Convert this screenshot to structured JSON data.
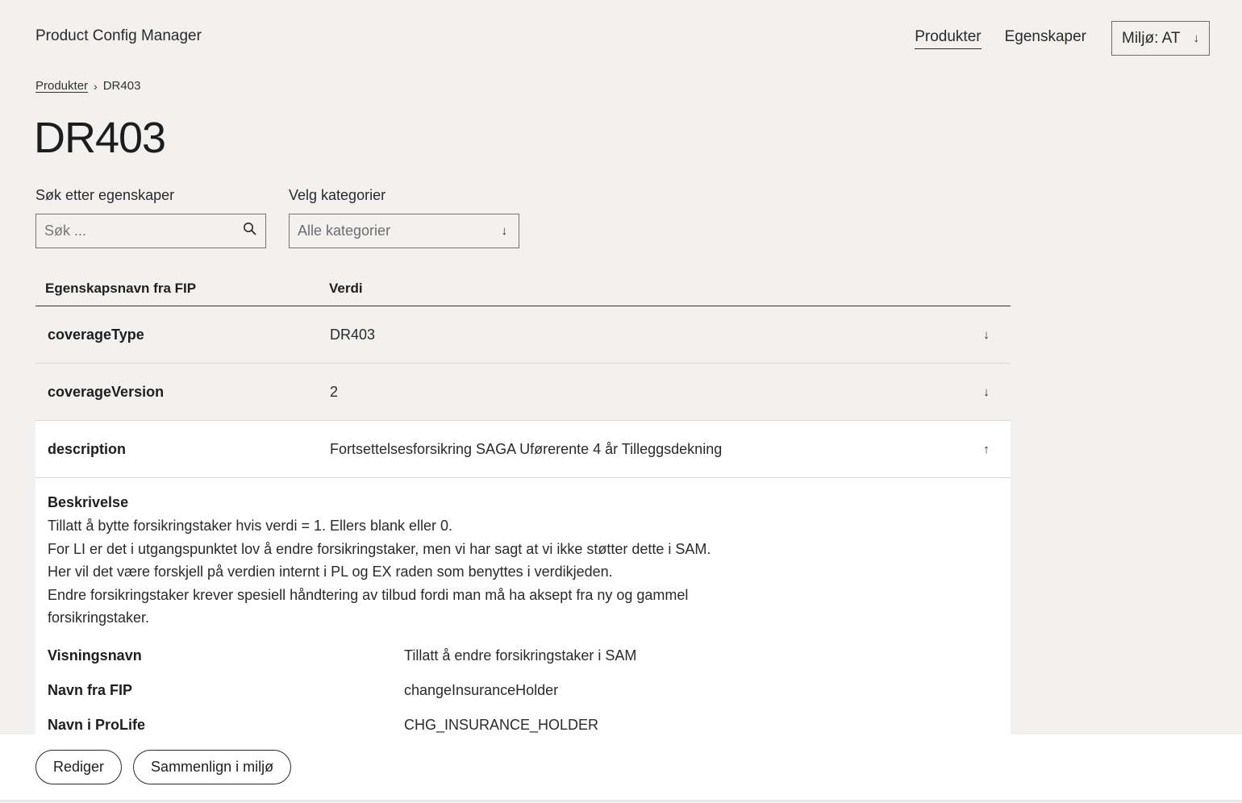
{
  "app": {
    "title": "Product Config Manager"
  },
  "nav": {
    "items": [
      {
        "label": "Produkter"
      },
      {
        "label": "Egenskaper"
      }
    ],
    "environment": {
      "label": "Miljø: AT",
      "arrow": "↓"
    }
  },
  "breadcrumb": {
    "parent": "Produkter",
    "separator": "›",
    "current": "DR403"
  },
  "page": {
    "title": "DR403"
  },
  "filters": {
    "search": {
      "label": "Søk etter egenskaper",
      "placeholder": "Søk ..."
    },
    "category": {
      "label": "Velg kategorier",
      "selected": "Alle kategorier",
      "arrow": "↓"
    }
  },
  "table": {
    "headers": {
      "name": "Egenskapsnavn fra FIP",
      "value": "Verdi"
    },
    "rows": [
      {
        "name": "coverageType",
        "value": "DR403",
        "toggle": "↓"
      },
      {
        "name": "coverageVersion",
        "value": "2",
        "toggle": "↓"
      },
      {
        "name": "description",
        "value": "Fortsettelsesforsikring SAGA Uførerente 4 år Tilleggsdekning",
        "toggle": "↑"
      }
    ],
    "detail": {
      "heading": "Beskrivelse",
      "lines": [
        "Tillatt å bytte forsikringstaker hvis verdi = 1. Ellers blank eller 0.",
        "For LI er det i utgangspunktet lov å endre forsikringstaker, men vi har sagt at vi ikke støtter dette i SAM.",
        "Her vil det være forskjell på verdien internt i PL og EX raden som benyttes i verdikjeden.",
        "Endre forsikringstaker krever spesiell håndtering av tilbud fordi man må ha aksept fra ny og gammel forsikringstaker."
      ],
      "properties": [
        {
          "key": "Visningsnavn",
          "value": "Tillatt å endre forsikringstaker i SAM"
        },
        {
          "key": "Navn fra FIP",
          "value": "changeInsuranceHolder"
        },
        {
          "key": "Navn i ProLife",
          "value": "CHG_INSURANCE_HOLDER"
        }
      ]
    }
  },
  "footer": {
    "edit_label": "Rediger",
    "compare_label": "Sammenlign i miljø"
  }
}
